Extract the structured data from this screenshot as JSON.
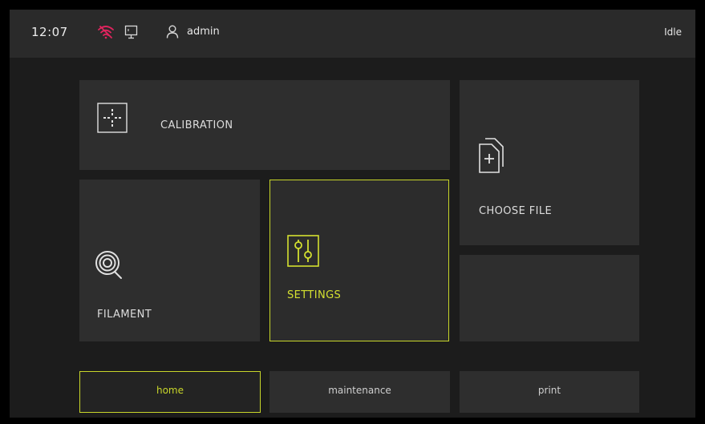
{
  "topbar": {
    "time": "12:07",
    "wifi_icon": "wifi-disconnected-icon",
    "wifi_color": "#e0245e",
    "network_icon": "network-icon",
    "user_icon": "user-icon",
    "username": "admin",
    "status": "Idle"
  },
  "tiles": {
    "calibration": {
      "label": "CALIBRATION",
      "icon": "crosshair-icon"
    },
    "filament": {
      "label": "FILAMENT",
      "icon": "filament-spool-icon"
    },
    "settings": {
      "label": "SETTINGS",
      "icon": "sliders-icon",
      "selected": true
    },
    "choose_file": {
      "label": "CHOOSE FILE",
      "icon": "add-file-icon"
    }
  },
  "nav": {
    "tabs": [
      {
        "label": "home",
        "active": true
      },
      {
        "label": "maintenance",
        "active": false
      },
      {
        "label": "print",
        "active": false
      }
    ]
  },
  "colors": {
    "accent": "#c8d62a",
    "background": "#1c1c1c",
    "tile": "#2e2e2e",
    "topbar": "#2a2a2a"
  }
}
